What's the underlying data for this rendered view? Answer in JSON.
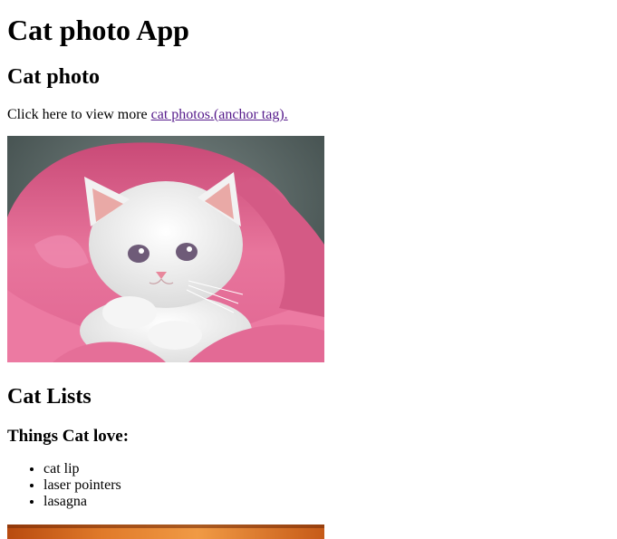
{
  "page": {
    "title": "Cat photo App",
    "section1_heading": "Cat photo",
    "intro_text": "Click here to view more ",
    "link_text": "cat photos.(anchor tag).",
    "section2_heading": "Cat Lists",
    "subheading": "Things Cat love:",
    "list_items": [
      "cat lip",
      "laser pointers",
      "lasagna"
    ]
  },
  "colors": {
    "link": "#551a8b",
    "blanket_pink": "#e2668f",
    "background_dark": "#3f4f50"
  },
  "images": {
    "cat_photo": "kitten-in-pink-blanket",
    "second_photo": "orange-cat-photo-partial"
  }
}
